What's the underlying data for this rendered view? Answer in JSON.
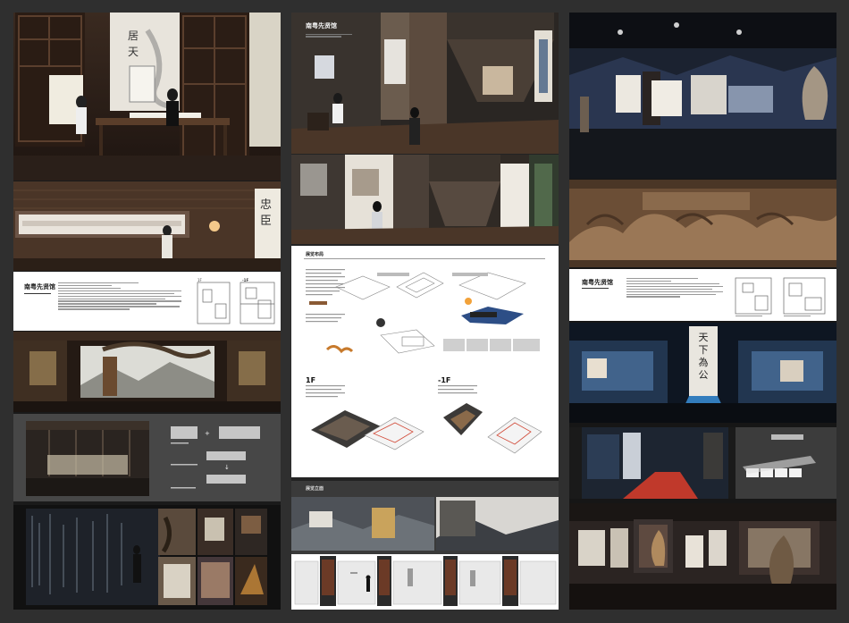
{
  "boards": {
    "left": {
      "info_title": "南粤先贤馆",
      "plan_label": "-1F"
    },
    "center": {
      "title": "南粤先贤馆",
      "section_layout": "展览布局",
      "floor_1f": "1F",
      "floor_b1": "-1F",
      "section_elevation": "展览立面"
    },
    "right": {
      "info_title": "南粤先贤馆",
      "banner_text": "天下為公"
    }
  },
  "colors": {
    "board_bg": "#2f2f2f",
    "accent_blue": "#3a8fd8",
    "accent_red": "#c0392b"
  }
}
